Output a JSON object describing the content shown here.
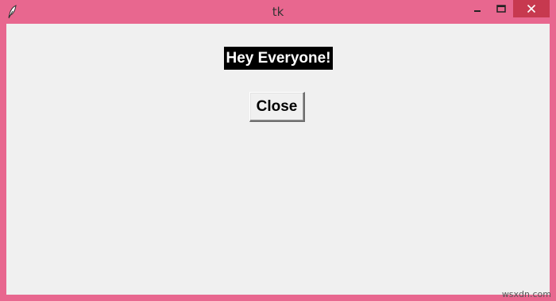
{
  "window": {
    "title": "tk",
    "app_icon": "feather-icon",
    "controls": {
      "minimize_icon": "minimize-icon",
      "maximize_icon": "maximize-icon",
      "close_icon": "close-icon"
    },
    "frame_color": "#e8678f",
    "close_control_color": "#c7394f"
  },
  "content": {
    "greeting_label": "Hey Everyone!",
    "close_button_label": "Close",
    "background_color": "#f0f0f0"
  },
  "watermark": "wsxdn.com"
}
